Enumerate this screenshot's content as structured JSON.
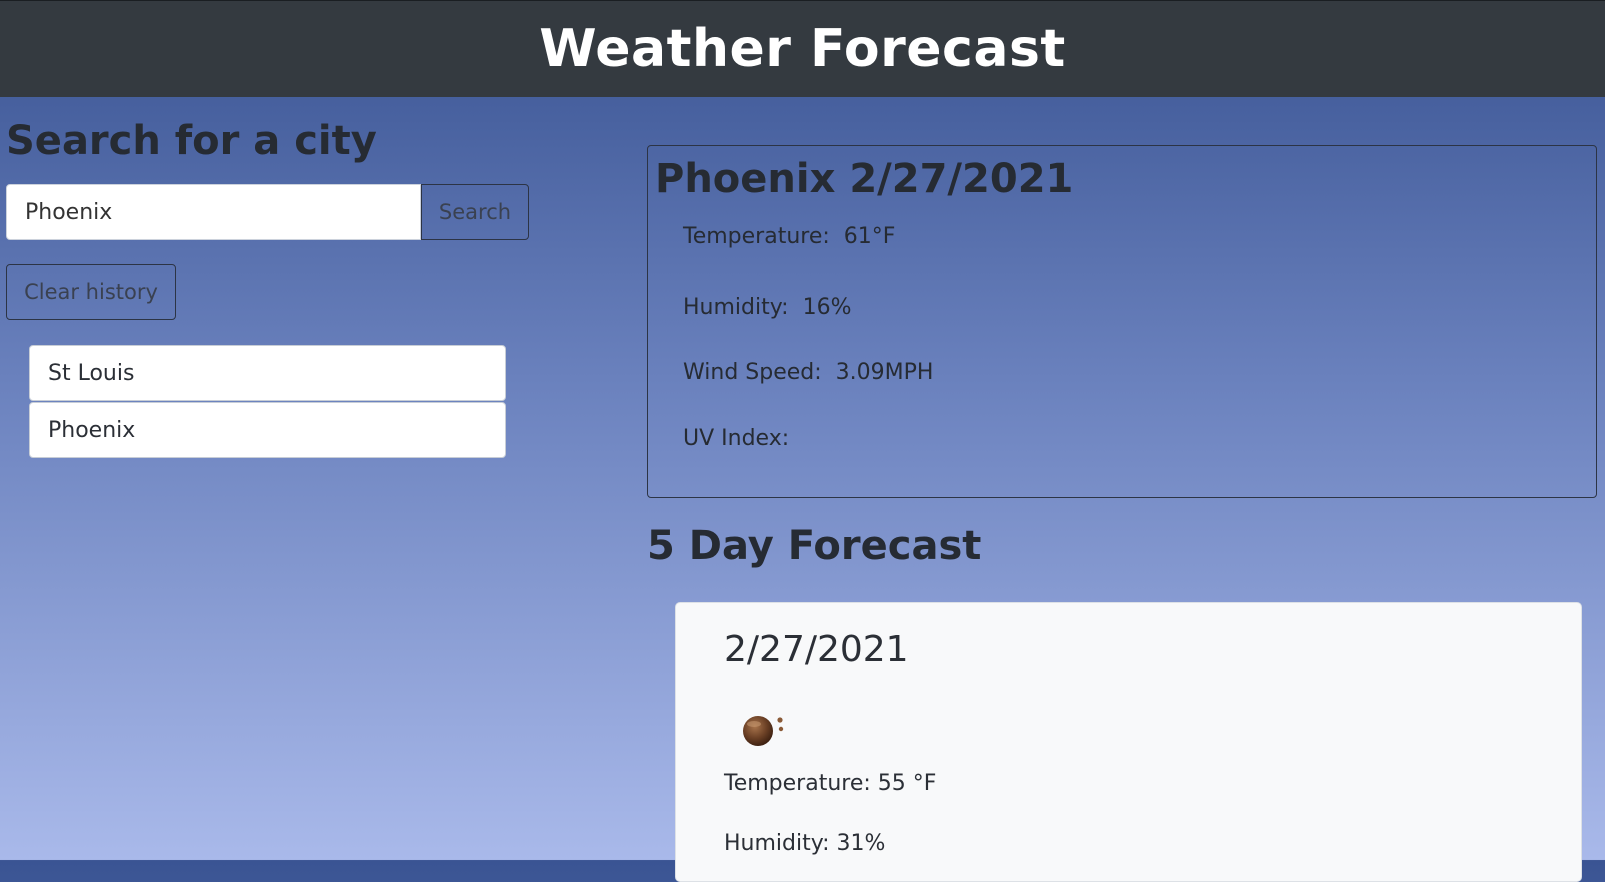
{
  "header": {
    "title": "Weather Forecast"
  },
  "search": {
    "heading": "Search for a city",
    "input_value": "Phoenix",
    "button_label": "Search",
    "clear_label": "Clear history"
  },
  "history": {
    "items": [
      "St Louis",
      "Phoenix"
    ]
  },
  "current": {
    "title": "Phoenix 2/27/2021",
    "temperature_label": "Temperature:",
    "temperature_value": "61°F",
    "humidity_label": "Humidity:",
    "humidity_value": "16%",
    "wind_label": "Wind Speed:",
    "wind_value": "3.09MPH",
    "uv_label": "UV Index:"
  },
  "forecast": {
    "heading": "5 Day Forecast",
    "days": [
      {
        "date": "2/27/2021",
        "icon": "clear-night-icon",
        "temperature": "Temperature: 55 °F",
        "humidity": "Humidity: 31%"
      }
    ]
  }
}
